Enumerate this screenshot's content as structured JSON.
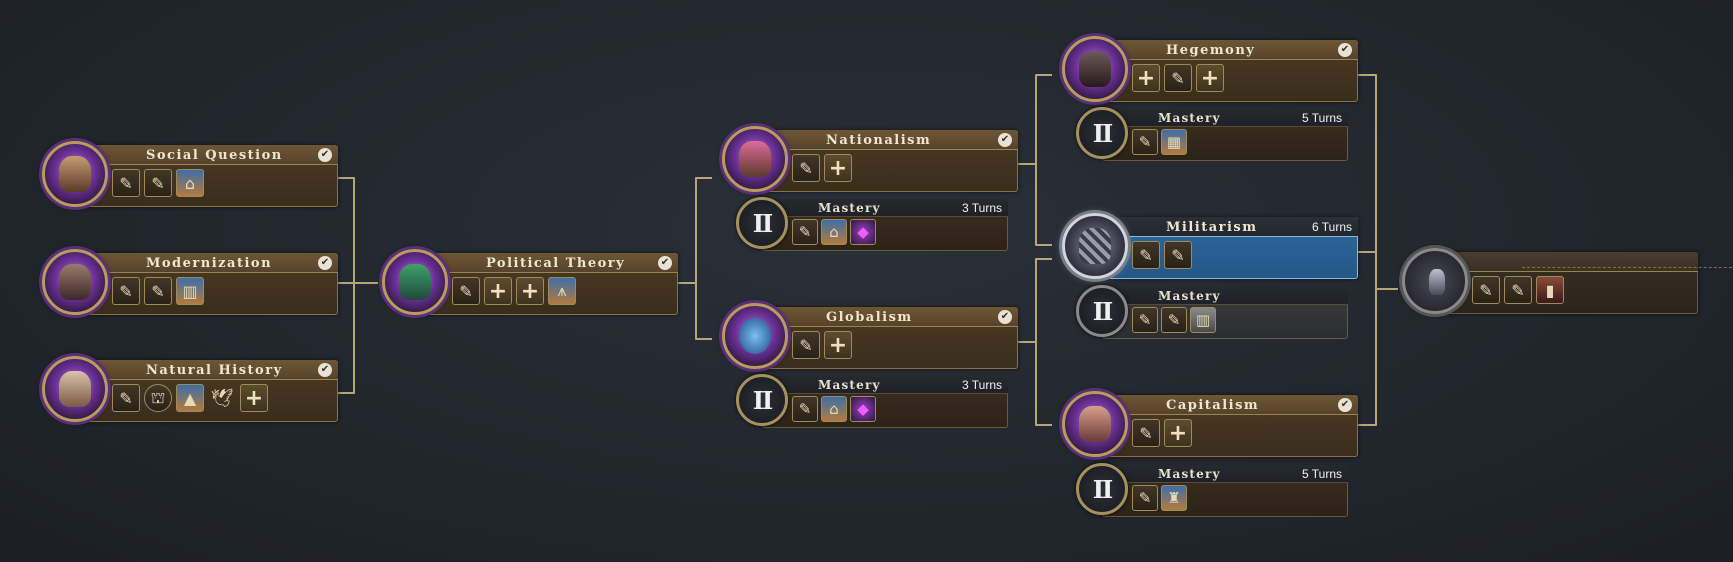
{
  "civics": {
    "social_question": {
      "title": "Social Question",
      "completed": "✔",
      "icons": [
        "quill",
        "quill",
        "building"
      ]
    },
    "modernization": {
      "title": "Modernization",
      "completed": "✔",
      "icons": [
        "quill",
        "quill",
        "building"
      ]
    },
    "natural_history": {
      "title": "Natural History",
      "completed": "✔",
      "icons": [
        "quill",
        "museum",
        "building",
        "dove",
        "plus"
      ]
    },
    "political_theory": {
      "title": "Political Theory",
      "completed": "✔",
      "icons": [
        "quill",
        "plus",
        "plus",
        "building"
      ]
    },
    "nationalism": {
      "title": "Nationalism",
      "completed": "✔",
      "icons": [
        "quill",
        "plus"
      ],
      "mastery": {
        "numeral": "II",
        "title": "Mastery",
        "turns": "3 Turns",
        "icons": [
          "quill",
          "building",
          "gem"
        ]
      }
    },
    "globalism": {
      "title": "Globalism",
      "completed": "✔",
      "icons": [
        "quill",
        "plus"
      ],
      "mastery": {
        "numeral": "II",
        "title": "Mastery",
        "turns": "3 Turns",
        "icons": [
          "quill",
          "building",
          "gem"
        ]
      }
    },
    "hegemony": {
      "title": "Hegemony",
      "completed": "✔",
      "icons": [
        "plus",
        "quill",
        "plus"
      ],
      "mastery": {
        "numeral": "II",
        "title": "Mastery",
        "turns": "5 Turns",
        "icons": [
          "quill",
          "building"
        ]
      }
    },
    "militarism": {
      "title": "Militarism",
      "turns": "6 Turns",
      "icons": [
        "quill",
        "quill"
      ],
      "mastery": {
        "numeral": "II",
        "title": "Mastery",
        "icons": [
          "quill",
          "quill",
          "building"
        ]
      }
    },
    "capitalism": {
      "title": "Capitalism",
      "completed": "✔",
      "icons": [
        "quill",
        "plus"
      ],
      "mastery": {
        "numeral": "II",
        "title": "Mastery",
        "turns": "5 Turns",
        "icons": [
          "quill",
          "statue"
        ]
      }
    },
    "future": {
      "icons": [
        "quill",
        "quill",
        "building"
      ]
    }
  },
  "colors": {
    "line": "#b8a57a",
    "active": "#2f6a9c",
    "accent": "#6a2f96"
  }
}
